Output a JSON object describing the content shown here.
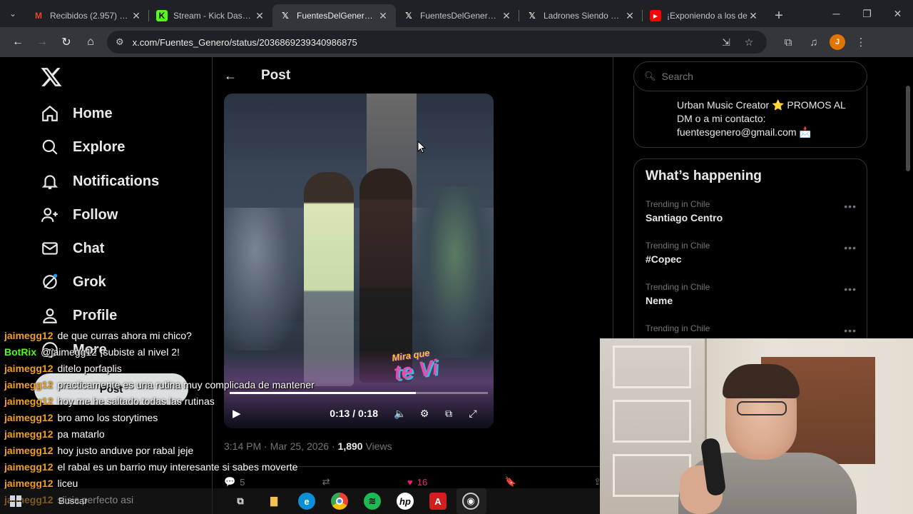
{
  "browser": {
    "tabs": [
      {
        "title": "Recibidos (2.957) - jo",
        "favicon": "gmail-icon",
        "color": "#ea4335",
        "active": false
      },
      {
        "title": "Stream - Kick Dashbo",
        "favicon": "kick-icon",
        "color": "#53fc18",
        "active": false
      },
      {
        "title": "FuentesDelGenero on",
        "favicon": "x-icon",
        "color": "#ffffff",
        "active": true
      },
      {
        "title": "FuentesDelGenero on",
        "favicon": "x-icon",
        "color": "#ffffff",
        "active": false
      },
      {
        "title": "Ladrones Siendo Don",
        "favicon": "x-icon",
        "color": "#ffffff",
        "active": false
      },
      {
        "title": "¡Exponiendo a los de",
        "favicon": "youtube-icon",
        "color": "#ff0000",
        "active": false
      }
    ],
    "url": "x.com/Fuentes_Genero/status/2036869239340986875",
    "profile_initial": "J"
  },
  "nav": {
    "items": [
      {
        "label": "Home",
        "icon": "home-icon"
      },
      {
        "label": "Explore",
        "icon": "search-icon"
      },
      {
        "label": "Notifications",
        "icon": "bell-icon"
      },
      {
        "label": "Follow",
        "icon": "follow-icon"
      },
      {
        "label": "Chat",
        "icon": "mail-icon"
      },
      {
        "label": "Grok",
        "icon": "grok-icon"
      },
      {
        "label": "Profile",
        "icon": "profile-icon"
      },
      {
        "label": "More",
        "icon": "more-icon"
      }
    ],
    "post_button": "Post"
  },
  "post": {
    "header_title": "Post",
    "video": {
      "time": "0:13 / 0:18",
      "progress": 0.72,
      "watermark_line1": "Mira que",
      "watermark_line2": "te Vi"
    },
    "time": "3:14 PM",
    "date": "Mar 25, 2026",
    "views_count": "1,890",
    "views_label": "Views",
    "replies": "5",
    "likes": "16"
  },
  "sidebar": {
    "search_placeholder": "Search",
    "bio": "Urban Music Creator ⭐ PROMOS AL DM o a mi contacto: fuentesgenero@gmail.com 📩",
    "whats_happening": "What’s happening",
    "trends": [
      {
        "context": "Trending in Chile",
        "name": "Santiago Centro"
      },
      {
        "context": "Trending in Chile",
        "name": "#Copec"
      },
      {
        "context": "Trending in Chile",
        "name": "Neme"
      },
      {
        "context": "Trending in Chile",
        "name": ""
      }
    ]
  },
  "chat": [
    {
      "user": "jaimegg12",
      "color": "#f0a020",
      "msg": "de que curras ahora mi chico?"
    },
    {
      "user": "BotRix",
      "color": "#53fc18",
      "msg": "@jaimegg12 ¡subiste al nivel 2!"
    },
    {
      "user": "jaimegg12",
      "color": "#f0a020",
      "msg": "ditelo porfaplis"
    },
    {
      "user": "jaimegg12",
      "color": "#f0a020",
      "msg": "practicamente es una rutina muy complicada de mantener"
    },
    {
      "user": "jaimegg12",
      "color": "#f0a020",
      "msg": "hoy me he saltado todas las rutinas"
    },
    {
      "user": "jaimegg12",
      "color": "#f0a020",
      "msg": "bro amo los storytimes"
    },
    {
      "user": "jaimegg12",
      "color": "#f0a020",
      "msg": "pa matarlo"
    },
    {
      "user": "jaimegg12",
      "color": "#f0a020",
      "msg": "hoy justo anduve por rabal jeje"
    },
    {
      "user": "jaimegg12",
      "color": "#f0a020",
      "msg": "el rabal es un barrio muy interesante si sabes moverte"
    },
    {
      "user": "jaimegg12",
      "color": "#f0a020",
      "msg": "liceu"
    },
    {
      "user": "jaimegg12",
      "color": "#f0a020",
      "msg": "siisis perfecto asi"
    }
  ],
  "taskbar": {
    "search_label": "Buscar",
    "apps": [
      "task-view-icon",
      "file-explorer-icon",
      "edge-icon",
      "chrome-icon",
      "spotify-icon",
      "hp-icon",
      "adobe-icon",
      "obs-icon"
    ]
  }
}
